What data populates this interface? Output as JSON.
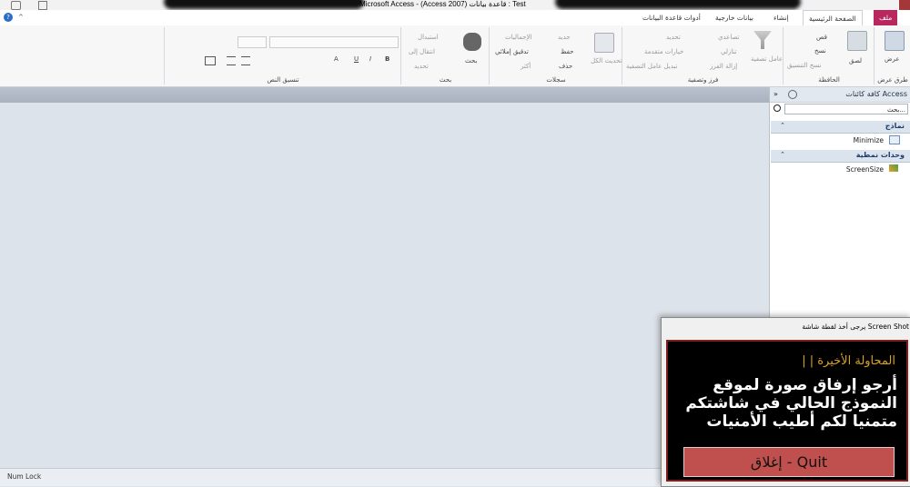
{
  "window": {
    "title": "Microsoft Access - (Access 2007) قاعدة بيانات : Test"
  },
  "tabs": {
    "file": "ملف",
    "home": "الصفحة الرئيسية",
    "create": "إنشاء",
    "external": "بيانات خارجية",
    "dbtools": "أدوات قاعدة البيانات"
  },
  "ribbon": {
    "views": {
      "view": "عرض",
      "label": "طرق عرض"
    },
    "clipboard": {
      "paste": "لصق",
      "cut": "قص",
      "copy": "نسخ",
      "format_painter": "نسخ التنسيق",
      "label": "الحافظة"
    },
    "sort_filter": {
      "filter": "عامل تصفية",
      "ascending": "تصاعدي",
      "descending": "تنازلي",
      "remove_sort": "إزالة الفرز",
      "selection": "تحديد",
      "advanced": "خيارات متقدمة",
      "toggle_filter": "تبديل عامل التصفية",
      "label": "فرز وتصفية"
    },
    "records": {
      "refresh": "تحديث الكل",
      "new": "جديد",
      "save": "حفظ",
      "delete": "حذف",
      "totals": "الإجماليات",
      "spelling": "تدقيق إملائي",
      "more": "أكثر",
      "label": "سجلات"
    },
    "find": {
      "find": "بحث",
      "replace": "استبدال",
      "goto": "انتقال إلى",
      "select": "تحديد",
      "label": "بحث"
    },
    "text_format": {
      "label": "تنسيق النص",
      "bold": "B",
      "italic": "I",
      "underline": "U",
      "font_color": "A"
    }
  },
  "nav": {
    "title": "كافة كائنات Access",
    "search_placeholder": "بحث...",
    "groups": [
      {
        "label": "نماذج",
        "items": [
          "Minimize"
        ]
      },
      {
        "label": "وحدات نمطية",
        "items": [
          "ScreenSize"
        ]
      }
    ]
  },
  "status": {
    "numlock": "Num Lock"
  },
  "dialog": {
    "title": "Screen Shot يرجى أخذ لقطة شاشة",
    "subtitle": "المحاولة الأخيرة | |",
    "message": "أرجو إرفاق صورة لموقع النموذج الحالي في شاشتكم متمنيا لكم أطيب الأمنيات",
    "quit_label": "إغلاق - Quit"
  },
  "colors": {
    "file_tab": "#b8285f",
    "dialog_accent": "#d9a21c",
    "quit_button": "#c0504d"
  }
}
